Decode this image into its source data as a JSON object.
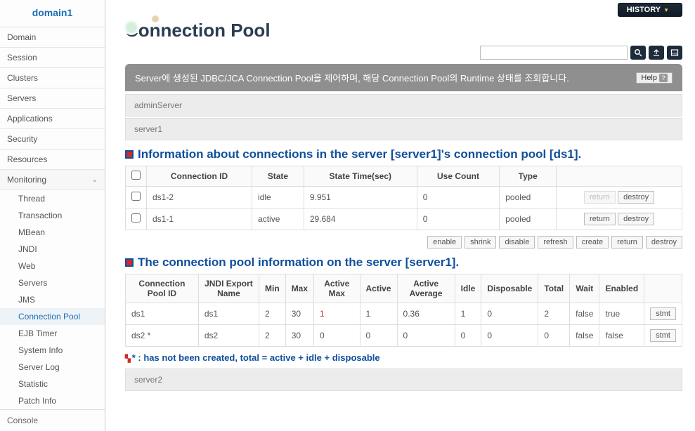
{
  "sidebar": {
    "header": "domain1",
    "items": [
      {
        "label": "Domain"
      },
      {
        "label": "Session"
      },
      {
        "label": "Clusters"
      },
      {
        "label": "Servers"
      },
      {
        "label": "Applications"
      },
      {
        "label": "Security"
      },
      {
        "label": "Resources"
      },
      {
        "label": "Monitoring"
      }
    ],
    "monitoring_sub": [
      {
        "label": "Thread"
      },
      {
        "label": "Transaction"
      },
      {
        "label": "MBean"
      },
      {
        "label": "JNDI"
      },
      {
        "label": "Web"
      },
      {
        "label": "Servers"
      },
      {
        "label": "JMS"
      },
      {
        "label": "Connection Pool",
        "active": true
      },
      {
        "label": "EJB Timer"
      },
      {
        "label": "System Info"
      },
      {
        "label": "Server Log"
      },
      {
        "label": "Statistic"
      },
      {
        "label": "Patch Info"
      }
    ],
    "console": "Console"
  },
  "top": {
    "history": "HISTORY",
    "title": "Connection Pool",
    "search_placeholder": ""
  },
  "banner": {
    "text": "Server에 생성된 JDBC/JCA Connection Pool을 제어하며, 해당 Connection Pool의 Runtime 상태를 조회합니다.",
    "help": "Help"
  },
  "servers": {
    "admin": "adminServer",
    "server1": "server1",
    "server2": "server2"
  },
  "section1": {
    "title": "Information about connections in the server [server1]'s connection pool [ds1].",
    "headers": {
      "id": "Connection ID",
      "state": "State",
      "time": "State Time(sec)",
      "use": "Use Count",
      "type": "Type"
    },
    "rows": [
      {
        "id": "ds1-2",
        "state": "idle",
        "time": "9.951",
        "use": "0",
        "type": "pooled",
        "return_enabled": false
      },
      {
        "id": "ds1-1",
        "state": "active",
        "time": "29.684",
        "use": "0",
        "type": "pooled",
        "return_enabled": true
      }
    ],
    "row_btn": {
      "return": "return",
      "destroy": "destroy"
    }
  },
  "poolbtns": {
    "enable": "enable",
    "shrink": "shrink",
    "disable": "disable",
    "refresh": "refresh",
    "create": "create",
    "return": "return",
    "destroy": "destroy"
  },
  "section2": {
    "title": "The connection pool information on the server [server1].",
    "headers": {
      "id": "Connection Pool ID",
      "jndi": "JNDI Export Name",
      "min": "Min",
      "max": "Max",
      "amax": "Active Max",
      "active": "Active",
      "avg": "Active Average",
      "idle": "Idle",
      "disp": "Disposable",
      "total": "Total",
      "wait": "Wait",
      "enabled": "Enabled"
    },
    "rows": [
      {
        "id": "ds1",
        "jndi": "ds1",
        "min": "2",
        "max": "30",
        "amax": "1",
        "amax_red": true,
        "active": "1",
        "avg": "0.36",
        "idle": "1",
        "disp": "0",
        "total": "2",
        "wait": "false",
        "enabled": "true"
      },
      {
        "id": "ds2 *",
        "jndi": "ds2",
        "min": "2",
        "max": "30",
        "amax": "0",
        "amax_red": false,
        "active": "0",
        "avg": "0",
        "idle": "0",
        "disp": "0",
        "total": "0",
        "wait": "false",
        "enabled": "false"
      }
    ],
    "row_btn": "stmt"
  },
  "footnote": "* : has not been created, total = active + idle + disposable"
}
